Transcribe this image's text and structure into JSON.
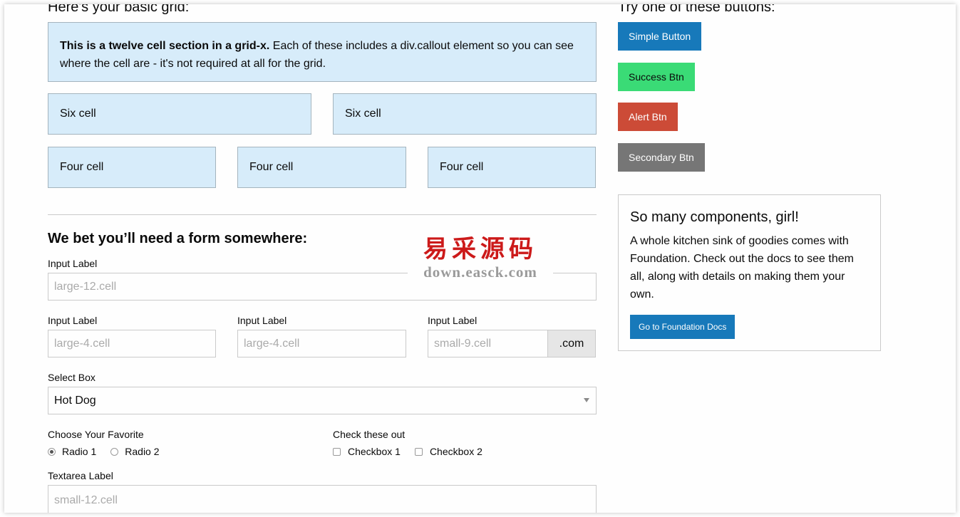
{
  "grid": {
    "heading": "Here's your basic grid:",
    "intro_bold": "This is a twelve cell section in a grid-x.",
    "intro_text": " Each of these includes a div.callout element so you can see where the cell are - it's not required at all for the grid.",
    "six_cells": [
      "Six cell",
      "Six cell"
    ],
    "four_cells": [
      "Four cell",
      "Four cell",
      "Four cell"
    ]
  },
  "form": {
    "title": "We bet you’ll need a form somewhere:",
    "input_label": "Input Label",
    "full_placeholder": "large-12.cell",
    "col1_label": "Input Label",
    "col1_placeholder": "large-4.cell",
    "col2_label": "Input Label",
    "col2_placeholder": "large-4.cell",
    "col3_label": "Input Label",
    "col3_placeholder": "small-9.cell",
    "col3_addon": ".com",
    "select_label": "Select Box",
    "select_value": "Hot Dog",
    "radio_label": "Choose Your Favorite",
    "radio_options": [
      "Radio 1",
      "Radio 2"
    ],
    "checkbox_label": "Check these out",
    "checkbox_options": [
      "Checkbox 1",
      "Checkbox 2"
    ],
    "textarea_label": "Textarea Label",
    "textarea_placeholder": "small-12.cell"
  },
  "buttons": {
    "heading": "Try one of these buttons:",
    "simple": "Simple Button",
    "success": "Success Btn",
    "alert": "Alert Btn",
    "secondary": "Secondary Btn"
  },
  "card": {
    "title": "So many components, girl!",
    "text": "A whole kitchen sink of goodies comes with Foundation. Check out the docs to see them all, along with details on making them your own.",
    "button": "Go to Foundation Docs"
  },
  "watermark": {
    "chinese": "易采源码",
    "url": "down.easck.com"
  },
  "colors": {
    "primary": "#1779ba",
    "success": "#3adb76",
    "alert": "#cc4b37",
    "secondary": "#767676",
    "callout": "#d7ecfa"
  }
}
